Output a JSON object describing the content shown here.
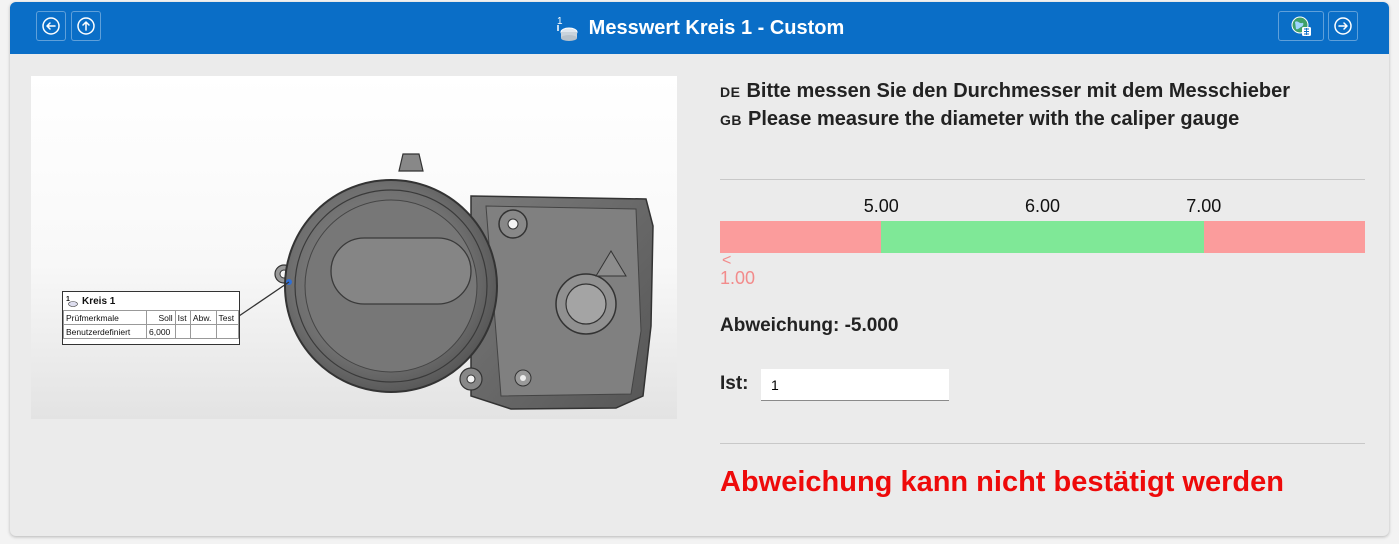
{
  "header": {
    "title": "Messwert Kreis 1 - Custom",
    "title_icon": "caliper-circle-icon",
    "left_buttons": [
      "back-arrow-icon",
      "up-arrow-icon"
    ],
    "right_buttons": [
      "globe-language-icon",
      "forward-arrow-icon"
    ],
    "color": "#0a6ec7"
  },
  "instructions": [
    {
      "lang": "DE",
      "text": "Bitte messen Sie den Durchmesser mit dem Messchieber"
    },
    {
      "lang": "GB",
      "text": "Please measure the diameter with the caliper gauge"
    }
  ],
  "scale": {
    "ticks": [
      "5.00",
      "6.00",
      "7.00"
    ],
    "min_value": 4.0,
    "max_value": 8.0,
    "lower_limit": 5.0,
    "upper_limit": 7.0,
    "ok_color": "#7fe897",
    "nok_color": "#fb9c9c",
    "marker_symbol": "<",
    "marker_value": "1.00"
  },
  "deviation": {
    "label": "Abweichung:",
    "value": "-5.000"
  },
  "ist": {
    "label": "Ist:",
    "value": "1"
  },
  "error_message": "Abweichung kann nicht bestätigt werden",
  "callout": {
    "title": "Kreis 1",
    "columns": [
      "Prüfmerkmale",
      "Soll",
      "Ist",
      "Abw.",
      "Test"
    ],
    "rows": [
      [
        "Benutzerdefiniert",
        "6,000",
        "",
        "",
        ""
      ]
    ]
  }
}
